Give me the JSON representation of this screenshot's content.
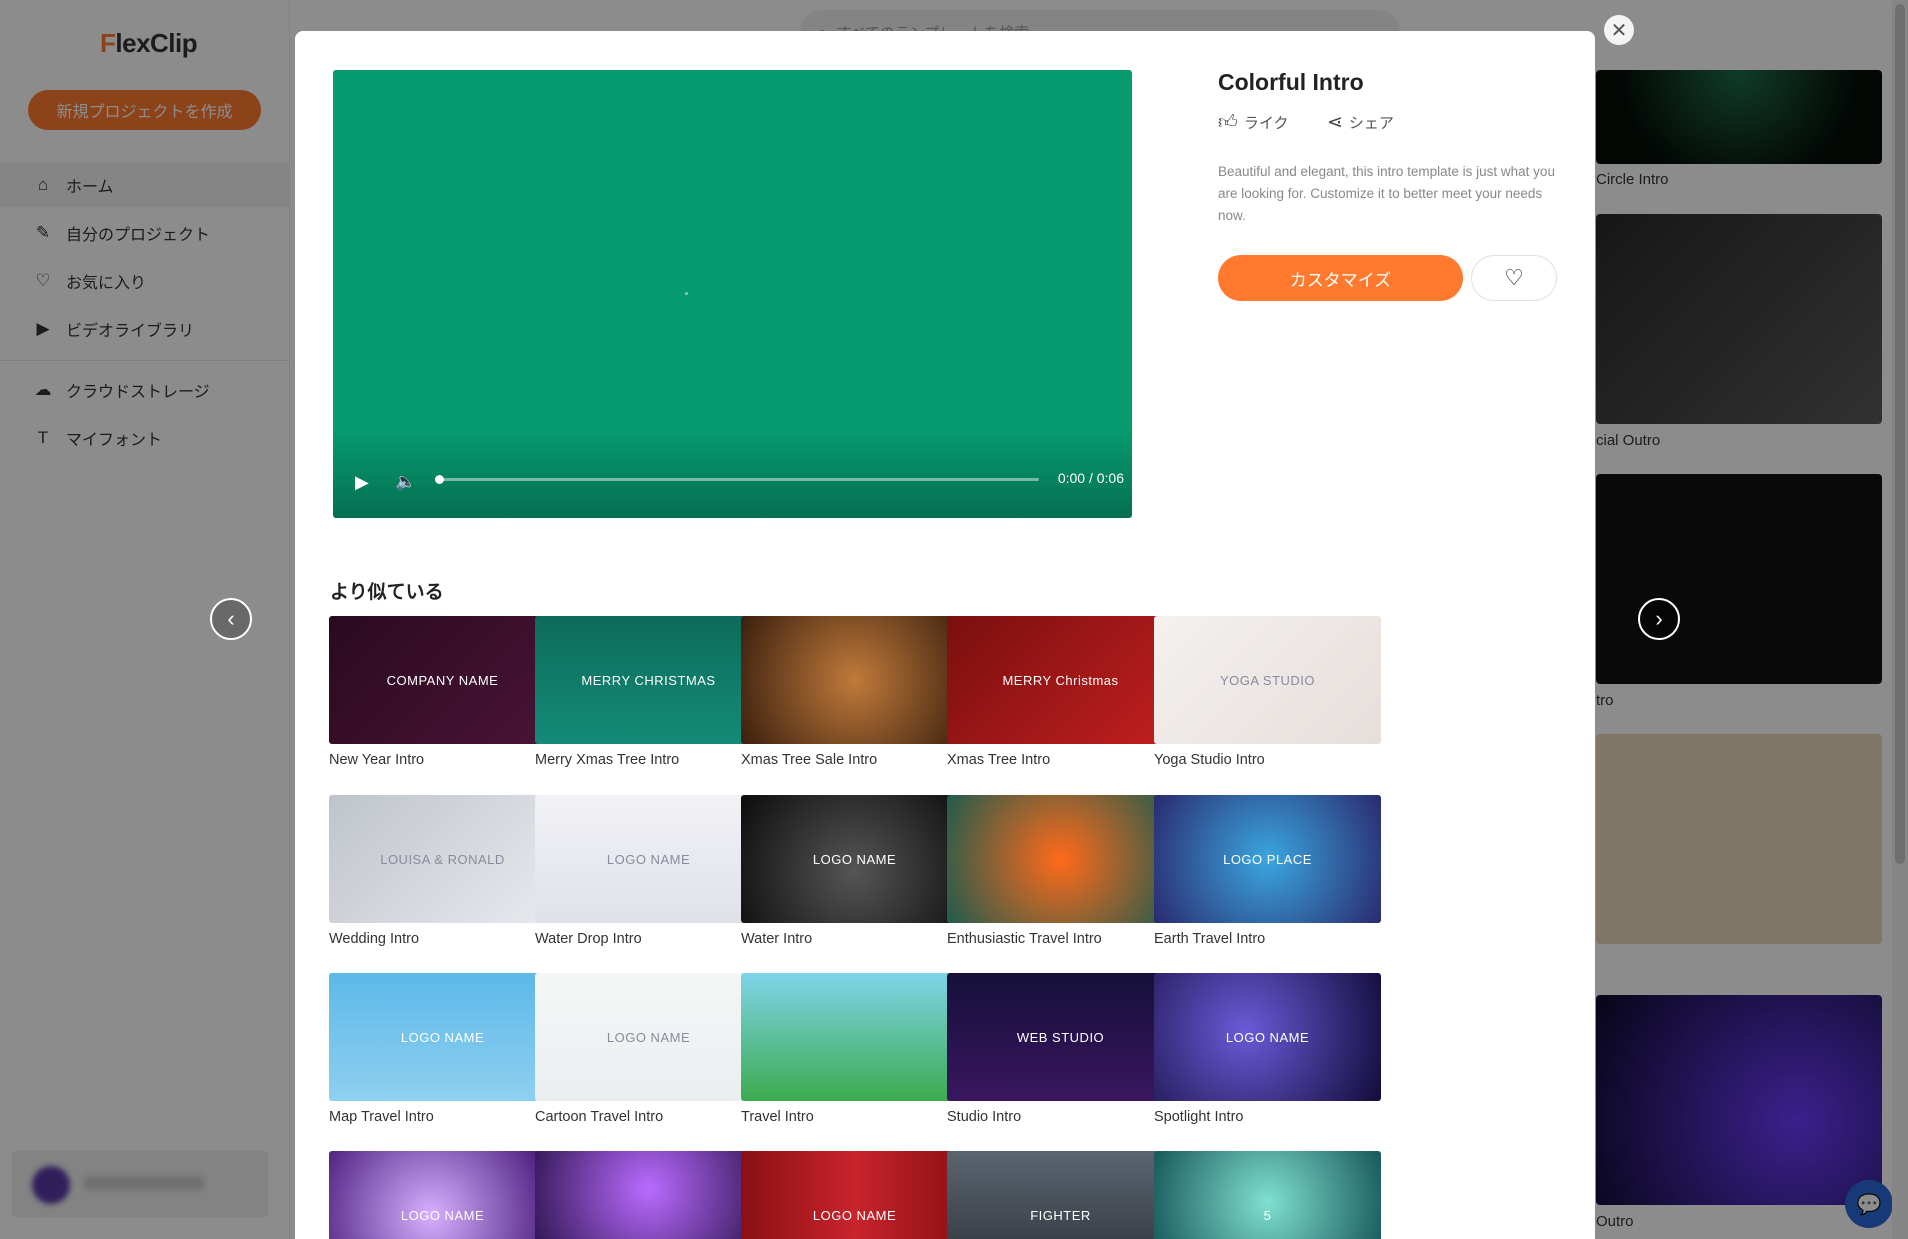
{
  "app": {
    "logo_rest": "lexClip",
    "logo_f": "F",
    "new_project": "新規プロジェクトを作成",
    "search_placeholder": "すべてのテンプレートを検索",
    "nav": [
      {
        "label": "ホーム",
        "icon": "home-icon",
        "glyph": "⌂"
      },
      {
        "label": "自分のプロジェクト",
        "icon": "edit-icon",
        "glyph": "✎"
      },
      {
        "label": "お気に入り",
        "icon": "heart-icon",
        "glyph": "♡"
      },
      {
        "label": "ビデオライブラリ",
        "icon": "video-library-icon",
        "glyph": "▶"
      },
      {
        "label": "クラウドストレージ",
        "icon": "cloud-icon",
        "glyph": "☁"
      },
      {
        "label": "マイフォント",
        "icon": "font-icon",
        "glyph": "T"
      }
    ],
    "background_captions": [
      "Circle Intro",
      "cial Outro",
      "tro",
      "",
      "Outro"
    ]
  },
  "modal": {
    "title": "Colorful Intro",
    "like": "ライク",
    "share": "シェア",
    "description": "Beautiful and elegant, this intro template is just what you are looking for. Customize it to better meet your needs now.",
    "customize": "カスタマイズ",
    "video": {
      "time": "0:00 / 0:06",
      "progress": 0.0,
      "color": "#079b70"
    },
    "similar_heading": "より似ている",
    "similar": [
      {
        "name": "New Year Intro",
        "text": "COMPANY NAME",
        "bg": "linear-gradient(135deg,#2a0a1e,#4a1436)"
      },
      {
        "name": "Merry Xmas Tree Intro",
        "text": "MERRY CHRISTMAS",
        "bg": "linear-gradient(180deg,#0e6b5a,#138b78)"
      },
      {
        "name": "Xmas Tree Sale Intro",
        "text": "",
        "bg": "radial-gradient(circle at 50% 50%,#c07a3a,#3a1f0e)"
      },
      {
        "name": "Xmas Tree Intro",
        "text": "MERRY Christmas",
        "bg": "linear-gradient(135deg,#7a0f0f,#c21f1f)"
      },
      {
        "name": "Yoga Studio Intro",
        "text": "YOGA STUDIO",
        "bg": "linear-gradient(135deg,#f4f1ef,#e6dedb)"
      },
      {
        "name": "Wedding Intro",
        "text": "LOUISA & RONALD",
        "bg": "linear-gradient(135deg,#bfc4cb,#e8eaee)"
      },
      {
        "name": "Water Drop Intro",
        "text": "LOGO NAME",
        "bg": "linear-gradient(180deg,#f2f2f6,#dfe2ea)"
      },
      {
        "name": "Water Intro",
        "text": "LOGO NAME",
        "bg": "radial-gradient(circle at 50% 60%,#555,#0c0c0c)"
      },
      {
        "name": "Enthusiastic Travel Intro",
        "text": "",
        "bg": "radial-gradient(circle at 50% 50%,#ff6a1a,#1f5b4d)"
      },
      {
        "name": "Earth Travel Intro",
        "text": "LOGO PLACE",
        "bg": "radial-gradient(circle at 50% 50%,#3aa6e0,#2a2a6e)"
      },
      {
        "name": "Map Travel Intro",
        "text": "LOGO NAME",
        "bg": "linear-gradient(180deg,#5cb8e8,#8fd0f0)"
      },
      {
        "name": "Cartoon Travel Intro",
        "text": "LOGO NAME",
        "bg": "linear-gradient(180deg,#f5f7f7,#e9eeee)"
      },
      {
        "name": "Travel Intro",
        "text": "",
        "bg": "linear-gradient(180deg,#7fd4ea,#3cab4e)"
      },
      {
        "name": "Studio Intro",
        "text": "WEB STUDIO",
        "bg": "linear-gradient(180deg,#15103a,#3a1660)"
      },
      {
        "name": "Spotlight Intro",
        "text": "LOGO NAME",
        "bg": "radial-gradient(circle at 40% 45%,#6b5ad8,#120c3a)"
      },
      {
        "name": "",
        "text": "LOGO NAME",
        "bg": "radial-gradient(circle at 45% 50%,#d6b0ff,#3a0c6e)"
      },
      {
        "name": "",
        "text": "",
        "bg": "radial-gradient(circle at 50% 30%,#b96bff,#1d0a3a)"
      },
      {
        "name": "",
        "text": "LOGO NAME",
        "bg": "linear-gradient(90deg,#8a0f14,#c8242b,#8a0f14)"
      },
      {
        "name": "",
        "text": "FIGHTER",
        "bg": "linear-gradient(180deg,#5a6470,#2e3238)"
      },
      {
        "name": "",
        "text": "5",
        "bg": "radial-gradient(circle at 50% 40%,#7fe0d0,#0e4a50)"
      }
    ]
  },
  "colors": {
    "accent": "#ff7a2f",
    "overlay": "rgba(0,0,0,0.45)"
  }
}
